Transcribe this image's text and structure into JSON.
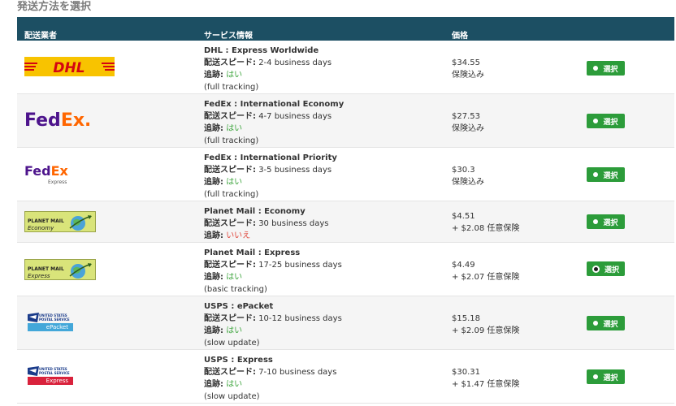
{
  "section_title": "発送方法を選択",
  "headers": {
    "carrier": "配送業者",
    "service": "サービス情報",
    "price": "価格"
  },
  "labels": {
    "speed": "配送スピード:",
    "tracking": "追跡:"
  },
  "select_label": "選択",
  "colors": {
    "header_bg": "#1c4f63",
    "button_green": "#2c9c3a",
    "yes": "#3ea53e",
    "no": "#e0463b"
  },
  "rows": [
    {
      "logo": "dhl-logo",
      "logo_text": "DHL",
      "name": "DHL : Express Worldwide",
      "speed": "2-4 business days",
      "tracking": "はい",
      "tracking_note": "(full tracking)",
      "price": "$34.55",
      "insurance": "保険込み",
      "selected": false
    },
    {
      "logo": "fedex-logo",
      "logo_text": "FedEx.",
      "name": "FedEx : International Economy",
      "speed": "4-7 business days",
      "tracking": "はい",
      "tracking_note": "(full tracking)",
      "price": "$27.53",
      "insurance": "保険込み",
      "selected": false
    },
    {
      "logo": "fedex-express-logo",
      "logo_text": "FedEx",
      "logo_sub": "Express",
      "name": "FedEx : International Priority",
      "speed": "3-5 business days",
      "tracking": "はい",
      "tracking_note": "(full tracking)",
      "price": "$30.3",
      "insurance": "保険込み",
      "selected": false
    },
    {
      "logo": "planet-mail-logo",
      "logo_text": "PLANET MAIL",
      "logo_sub": "Economy",
      "name": "Planet Mail : Economy",
      "speed": "30 business days",
      "tracking": "いいえ",
      "tracking_note": "",
      "price": "$4.51",
      "insurance": "+ $2.08 任意保険",
      "selected": false
    },
    {
      "logo": "planet-mail-logo",
      "logo_text": "PLANET MAIL",
      "logo_sub": "Express",
      "name": "Planet Mail : Express",
      "speed": "17-25 business days",
      "tracking": "はい",
      "tracking_note": "(basic tracking)",
      "price": "$4.49",
      "insurance": "+ $2.07 任意保険",
      "selected": true
    },
    {
      "logo": "usps-logo",
      "logo_text": "UNITED STATES POSTAL SERVICE",
      "logo_sub": "ePacket",
      "name": "USPS : ePacket",
      "speed": "10-12 business days",
      "tracking": "はい",
      "tracking_note": "(slow update)",
      "price": "$15.18",
      "insurance": "+ $2.09 任意保険",
      "selected": false
    },
    {
      "logo": "usps-logo",
      "logo_text": "UNITED STATES POSTAL SERVICE",
      "logo_sub": "Express",
      "name": "USPS : Express",
      "speed": "7-10 business days",
      "tracking": "はい",
      "tracking_note": "(slow update)",
      "price": "$30.31",
      "insurance": "+ $1.47 任意保険",
      "selected": false
    }
  ]
}
